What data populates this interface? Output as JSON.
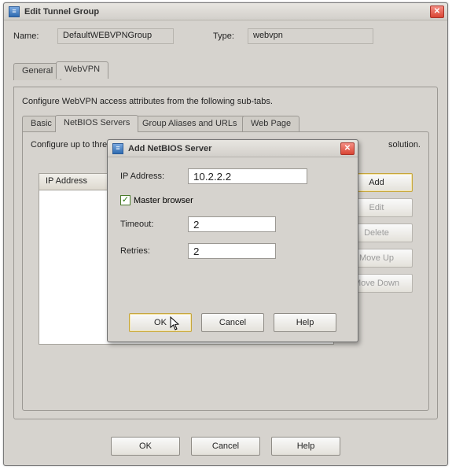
{
  "window": {
    "title": "Edit Tunnel Group",
    "name_label": "Name:",
    "name_value": "DefaultWEBVPNGroup",
    "type_label": "Type:",
    "type_value": "webvpn"
  },
  "tabs": {
    "general": "General",
    "webvpn": "WebVPN"
  },
  "webvpn_panel": {
    "description": "Configure WebVPN access attributes from the following sub-tabs.",
    "subtabs": {
      "basic": "Basic",
      "netbios": "NetBIOS Servers",
      "aliases": "Group Aliases and URLs",
      "webpage": "Web Page"
    },
    "netbios_text_left": "Configure up to three",
    "netbios_text_right": "solution.",
    "list_header": "IP Address",
    "buttons": {
      "add": "Add",
      "edit": "Edit",
      "delete": "Delete",
      "moveup": "Move Up",
      "movedown": "Move Down"
    }
  },
  "bottom": {
    "ok": "OK",
    "cancel": "Cancel",
    "help": "Help"
  },
  "modal": {
    "title": "Add NetBIOS Server",
    "ip_label": "IP Address:",
    "ip_value": "10.2.2.2",
    "master_label": "Master browser",
    "master_checked": true,
    "timeout_label": "Timeout:",
    "timeout_value": "2",
    "retries_label": "Retries:",
    "retries_value": "2",
    "ok": "OK",
    "cancel": "Cancel",
    "help": "Help"
  }
}
